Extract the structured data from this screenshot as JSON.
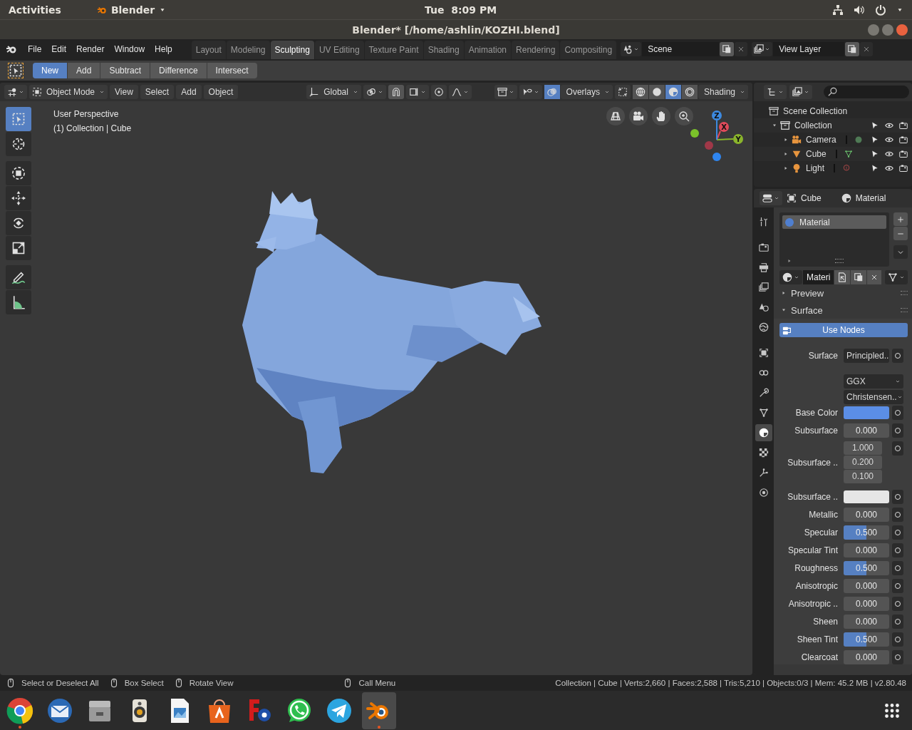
{
  "top_panel": {
    "activities": "Activities",
    "app_menu": "Blender",
    "clock": "Tue  8:09 PM"
  },
  "window": {
    "title": "Blender* [/home/ashlin/KOZHI.blend]"
  },
  "menus": [
    "File",
    "Edit",
    "Render",
    "Window",
    "Help"
  ],
  "workspaces": [
    {
      "label": "Layout",
      "selected": false
    },
    {
      "label": "Modeling",
      "selected": false
    },
    {
      "label": "Sculpting",
      "selected": true
    },
    {
      "label": "UV Editing",
      "selected": false
    },
    {
      "label": "Texture Paint",
      "selected": false
    },
    {
      "label": "Shading",
      "selected": false
    },
    {
      "label": "Animation",
      "selected": false
    },
    {
      "label": "Rendering",
      "selected": false
    },
    {
      "label": "Compositing",
      "selected": false
    }
  ],
  "scene": "Scene",
  "view_layer": "View Layer",
  "tool_settings": [
    {
      "label": "New",
      "selected": true
    },
    {
      "label": "Add",
      "selected": false
    },
    {
      "label": "Subtract",
      "selected": false
    },
    {
      "label": "Difference",
      "selected": false
    },
    {
      "label": "Intersect",
      "selected": false
    }
  ],
  "viewport": {
    "mode": "Object Mode",
    "menus": [
      "View",
      "Select",
      "Add",
      "Object"
    ],
    "orientation": "Global",
    "overlays": {
      "label": "Overlays",
      "on": true
    },
    "shading_label": "Shading",
    "shading_modes": [
      {
        "kind": "wireframe",
        "selected": false
      },
      {
        "kind": "solid",
        "selected": false
      },
      {
        "kind": "material",
        "selected": true
      },
      {
        "kind": "rendered",
        "selected": false
      }
    ],
    "info": [
      "User Perspective",
      "(1) Collection | Cube"
    ],
    "tools": [
      {
        "kind": "select_box",
        "selected": true
      },
      {
        "kind": "cursor",
        "selected": false
      },
      {
        "kind": "transform",
        "selected": false
      },
      {
        "kind": "move",
        "selected": false
      },
      {
        "kind": "rotate",
        "selected": false
      },
      {
        "kind": "scale",
        "selected": false
      },
      {
        "kind": "annotate",
        "selected": false
      },
      {
        "kind": "measure",
        "selected": false
      }
    ],
    "axes": [
      "X",
      "Y",
      "Z"
    ]
  },
  "outliner": {
    "items": [
      {
        "label": "Scene Collection",
        "kind": "scene_collection",
        "children": [
          {
            "label": "Collection",
            "kind": "collection",
            "expanded": true,
            "children": [
              {
                "label": "Camera",
                "kind": "camera",
                "expanded": false
              },
              {
                "label": "Cube",
                "kind": "mesh",
                "expanded": false
              },
              {
                "label": "Light",
                "kind": "light",
                "expanded": false
              }
            ]
          }
        ]
      }
    ]
  },
  "properties": {
    "object": "Cube",
    "context": "Material",
    "tabs": [
      {
        "kind": "tool",
        "selected": false
      },
      {
        "kind": "render",
        "selected": false
      },
      {
        "kind": "output",
        "selected": false
      },
      {
        "kind": "view_layer",
        "selected": false
      },
      {
        "kind": "scene",
        "selected": false
      },
      {
        "kind": "world",
        "selected": false
      },
      {
        "kind": "object",
        "selected": false
      },
      {
        "kind": "constraints",
        "selected": false
      },
      {
        "kind": "modifiers",
        "selected": false
      },
      {
        "kind": "data",
        "selected": false
      },
      {
        "kind": "material",
        "selected": true
      },
      {
        "kind": "texture",
        "selected": false
      },
      {
        "kind": "particles",
        "selected": false
      },
      {
        "kind": "physics",
        "selected": false
      }
    ],
    "slots": [
      {
        "name": "Material",
        "selected": true,
        "color": "#4f7fd0"
      }
    ],
    "material_name": "Materi",
    "panels": [
      {
        "label": "Preview",
        "expanded": false
      },
      {
        "label": "Surface",
        "expanded": true
      }
    ],
    "use_nodes": {
      "label": "Use Nodes",
      "on": true
    },
    "fields": [
      {
        "kind": "link",
        "label": "Surface",
        "value": "Principled.."
      },
      {
        "kind": "dropdown",
        "value": "GGX"
      },
      {
        "kind": "dropdown",
        "value": "Christensen.."
      },
      {
        "kind": "color",
        "label": "Base Color",
        "color": "#5b8ee6"
      },
      {
        "kind": "number",
        "label": "Subsurface",
        "value": "0.000",
        "level": 0
      },
      {
        "kind": "vector",
        "label": "Subsurface ..",
        "values": [
          "1.000",
          "0.200",
          "0.100"
        ]
      },
      {
        "kind": "color",
        "label": "Subsurface ..",
        "color": "#e6e6e6"
      },
      {
        "kind": "number",
        "label": "Metallic",
        "value": "0.000",
        "level": 0
      },
      {
        "kind": "number",
        "label": "Specular",
        "value": "0.500",
        "level": 0.5
      },
      {
        "kind": "number",
        "label": "Specular Tint",
        "value": "0.000",
        "level": 0
      },
      {
        "kind": "number",
        "label": "Roughness",
        "value": "0.500",
        "level": 0.5
      },
      {
        "kind": "number",
        "label": "Anisotropic",
        "value": "0.000",
        "level": 0
      },
      {
        "kind": "number",
        "label": "Anisotropic ..",
        "value": "0.000",
        "level": 0
      },
      {
        "kind": "number",
        "label": "Sheen",
        "value": "0.000",
        "level": 0
      },
      {
        "kind": "number",
        "label": "Sheen Tint",
        "value": "0.500",
        "level": 0.5
      },
      {
        "kind": "number",
        "label": "Clearcoat",
        "value": "0.000",
        "level": 0
      }
    ]
  },
  "status_bar": {
    "hints": [
      "Select or Deselect All",
      "Box Select",
      "Rotate View",
      "Call Menu"
    ],
    "stats": "Collection | Cube | Verts:2,660 | Faces:2,588 | Tris:5,210 | Objects:0/3 | Mem: 45.2 MB | v2.80.48"
  },
  "dock": [
    {
      "kind": "browser",
      "running": true,
      "selected": false
    },
    {
      "kind": "mail",
      "running": false,
      "selected": false
    },
    {
      "kind": "files",
      "running": false,
      "selected": false
    },
    {
      "kind": "music",
      "running": false,
      "selected": false
    },
    {
      "kind": "draw",
      "running": false,
      "selected": false
    },
    {
      "kind": "software",
      "running": false,
      "selected": false
    },
    {
      "kind": "sync",
      "running": false,
      "selected": false
    },
    {
      "kind": "chat",
      "running": false,
      "selected": false
    },
    {
      "kind": "messenger",
      "running": false,
      "selected": false
    },
    {
      "kind": "blender",
      "running": true,
      "selected": true
    }
  ]
}
